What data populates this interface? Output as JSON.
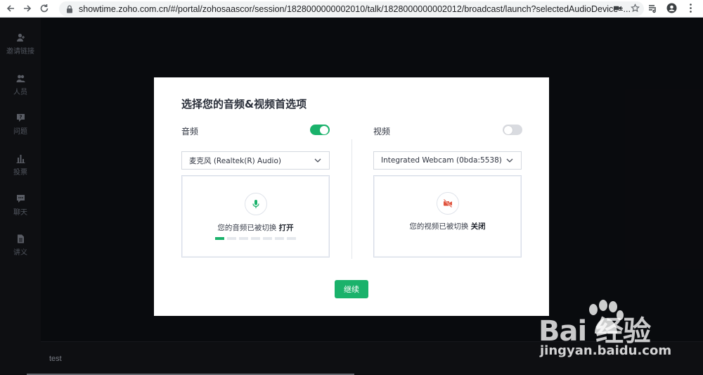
{
  "browser": {
    "url_host": "showtime.zoho.com.cn",
    "url_path": "/#/portal/zohosaascor/session/1828000000002010/talk/1828000000002012/broadcast/launch?selectedAudioDevice=..."
  },
  "sidebar": {
    "items": [
      {
        "label": "邀请链接",
        "icon": "person-add-icon"
      },
      {
        "label": "人员",
        "icon": "people-icon"
      },
      {
        "label": "问题",
        "icon": "question-icon"
      },
      {
        "label": "投票",
        "icon": "poll-icon"
      },
      {
        "label": "聊天",
        "icon": "chat-icon"
      },
      {
        "label": "讲义",
        "icon": "document-icon"
      }
    ]
  },
  "bottom_bar": {
    "text": "test"
  },
  "modal": {
    "title": "选择您的音频&视频首选项",
    "audio": {
      "label": "音频",
      "enabled": true,
      "device": "麦克风 (Realtek(R) Audio)",
      "status_prefix": "您的音频已被切换",
      "status_value": "打开",
      "level_active_bars": 1,
      "level_total_bars": 7
    },
    "video": {
      "label": "视频",
      "enabled": false,
      "device": "Integrated Webcam (0bda:5538)",
      "status_prefix": "您的视频已被切换",
      "status_value": "关闭"
    },
    "continue_label": "继续"
  },
  "watermark": {
    "brand": "Bai  经验",
    "site": "jingyan.baidu.com"
  },
  "colors": {
    "accent": "#1ab26b",
    "background": "#16181d",
    "mic_icon": "#1ab26b",
    "camera_off_icon": "#e0533d"
  }
}
